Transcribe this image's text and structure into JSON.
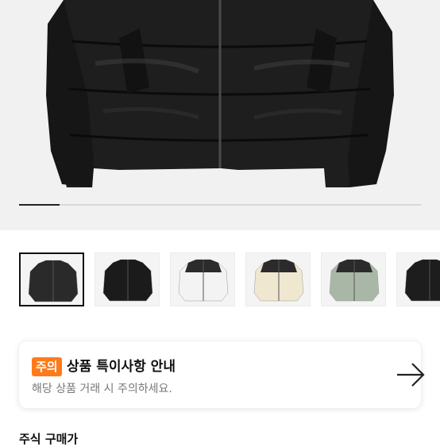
{
  "gallery": {
    "progress_fraction": 0.1,
    "thumbnails": [
      {
        "name": "black-matte",
        "color": "#2a2a2a",
        "accent": "#2a2a2a",
        "selected": true
      },
      {
        "name": "black-glossy",
        "color": "#1b1b1b",
        "accent": "#1b1b1b",
        "selected": false
      },
      {
        "name": "white",
        "color": "#f3f3f3",
        "accent": "#2b2b2b",
        "selected": false
      },
      {
        "name": "cream",
        "color": "#efe7cf",
        "accent": "#2b2b2b",
        "selected": false
      },
      {
        "name": "sage-green",
        "color": "#a9b8a6",
        "accent": "#2b2b2b",
        "selected": false
      },
      {
        "name": "black",
        "color": "#1d1d1d",
        "accent": "#1d1d1d",
        "selected": false
      }
    ]
  },
  "notice": {
    "badge": "주의",
    "title": "상품 특이사항 안내",
    "subtitle": "해당 상품 거래 시 주의하세요.",
    "accent_color": "#ff7a1a"
  },
  "next_section": {
    "peek_label": "주식 구매가"
  }
}
